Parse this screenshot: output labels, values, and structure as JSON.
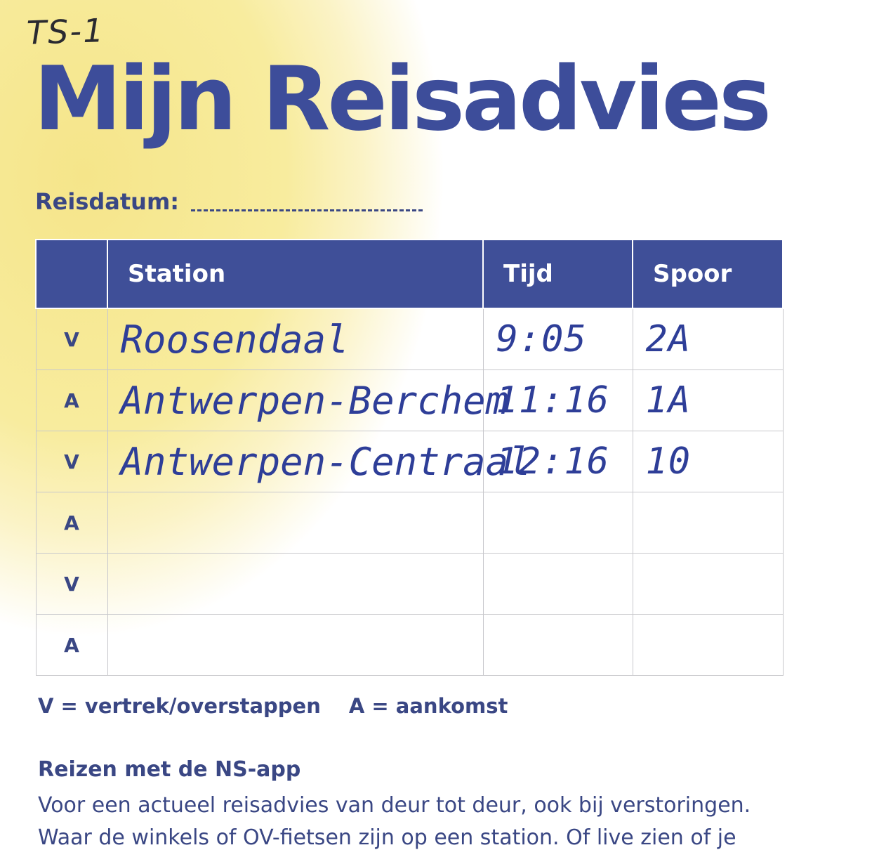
{
  "handwritten_note": "TS-1",
  "title": "Mijn Reisadvies",
  "reisdatum_label": "Reisdatum:",
  "table": {
    "headers": [
      "",
      "Station",
      "Tijd",
      "Spoor"
    ],
    "rows": [
      {
        "type": "V",
        "station": "Roosendaal",
        "tijd": "9:05",
        "spoor": "2A"
      },
      {
        "type": "A",
        "station": "Antwerpen-Berchem",
        "tijd": "11:16",
        "spoor": "1A"
      },
      {
        "type": "V",
        "station": "Antwerpen-Centraal",
        "tijd": "12:16",
        "spoor": "10"
      },
      {
        "type": "A",
        "station": "",
        "tijd": "",
        "spoor": ""
      },
      {
        "type": "V",
        "station": "",
        "tijd": "",
        "spoor": ""
      },
      {
        "type": "A",
        "station": "",
        "tijd": "",
        "spoor": ""
      }
    ]
  },
  "legend": {
    "v": "V = vertrek/overstappen",
    "a": "A = aankomst"
  },
  "section_heading": "Reizen met de NS-app",
  "body_lines": [
    "Voor een actueel reisadvies van deur tot deur, ook bij verstoringen.",
    "Waar de winkels of OV-fietsen zijn op een station. Of live zien of je"
  ],
  "colors": {
    "brand_blue": "#3f4f98",
    "text_blue": "#3a4784",
    "ink_blue": "#2e3e98",
    "yellow": "#f5e58a"
  }
}
